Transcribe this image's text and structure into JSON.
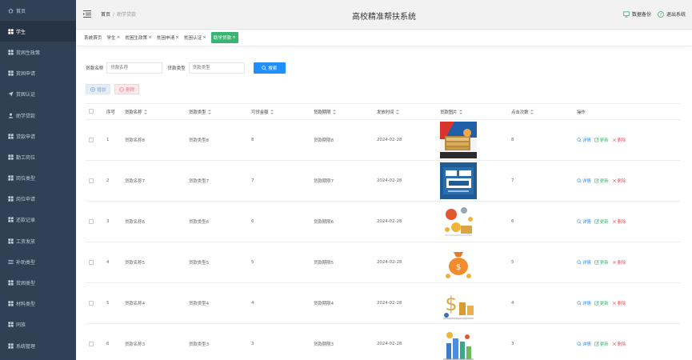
{
  "colors": {
    "sidebar_bg": "#304156",
    "accent_green": "#3bb372",
    "primary_blue": "#1e8ffc",
    "danger_red": "#e25b65"
  },
  "sidebar": {
    "items": [
      {
        "label": "首页",
        "icon": "home-icon"
      },
      {
        "label": "学生",
        "icon": "grid-icon"
      },
      {
        "label": "贫困生政策",
        "icon": "grid-icon"
      },
      {
        "label": "贫困申请",
        "icon": "grid-icon"
      },
      {
        "label": "贫困认证",
        "icon": "send-icon"
      },
      {
        "label": "助学贷款",
        "icon": "user-icon"
      },
      {
        "label": "贷款申请",
        "icon": "grid-icon"
      },
      {
        "label": "勤工岗位",
        "icon": "grid-icon"
      },
      {
        "label": "岗位类型",
        "icon": "grid-icon"
      },
      {
        "label": "岗位申请",
        "icon": "grid-icon"
      },
      {
        "label": "还款记录",
        "icon": "grid-icon"
      },
      {
        "label": "工资发放",
        "icon": "grid-icon"
      },
      {
        "label": "补助类型",
        "icon": "list-icon"
      },
      {
        "label": "贫困类型",
        "icon": "grid-icon"
      },
      {
        "label": "材料类型",
        "icon": "grid-icon"
      },
      {
        "label": "同族",
        "icon": "grid-icon"
      },
      {
        "label": "系统管理",
        "icon": "grid-icon"
      }
    ]
  },
  "header": {
    "breadcrumb_home": "首页",
    "breadcrumb_current": "助学贷款",
    "title": "高校精准帮扶系统",
    "backup_label": "数据备份",
    "logout_label": "退出系统"
  },
  "tabs": [
    {
      "label": "系统首页",
      "closable": false,
      "active": false
    },
    {
      "label": "学生",
      "closable": true,
      "active": false
    },
    {
      "label": "贫困生政策",
      "closable": true,
      "active": false
    },
    {
      "label": "贫困申请",
      "closable": true,
      "active": false
    },
    {
      "label": "贫困认证",
      "closable": true,
      "active": false
    },
    {
      "label": "助学贷款",
      "closable": true,
      "active": true
    }
  ],
  "tab_close_glyph": "×",
  "search": {
    "name_label": "贷款名称",
    "name_placeholder": "贷款名称",
    "type_label": "贷款类型",
    "type_placeholder": "贷款类型",
    "button_label": "搜索"
  },
  "actions": {
    "add_label": "增加",
    "delete_label": "删除"
  },
  "table": {
    "headers": {
      "index": "序号",
      "name": "贷款名称",
      "type": "贷款类型",
      "amount": "可贷金额",
      "term": "贷款期限",
      "time": "发放时间",
      "image": "贷款图片",
      "clicks": "点击次数",
      "ops": "操作"
    },
    "op_labels": {
      "view": "详情",
      "edit": "更新",
      "delete": "删除"
    },
    "rows": [
      {
        "index": "1",
        "name": "贷款名称8",
        "type": "贷款类型8",
        "amount": "8",
        "term": "贷款期限8",
        "time": "2024-02-28",
        "clicks": "8",
        "image": "dollar-stack-image"
      },
      {
        "index": "2",
        "name": "贷款名称7",
        "type": "贷款类型7",
        "amount": "7",
        "term": "贷款期限7",
        "time": "2024-02-28",
        "clicks": "7",
        "image": "loan-poster-image"
      },
      {
        "index": "3",
        "name": "贷款名称6",
        "type": "贷款类型6",
        "amount": "6",
        "term": "贷款期限6",
        "time": "2024-02-28",
        "clicks": "6",
        "image": "coins-illustration-image"
      },
      {
        "index": "4",
        "name": "贷款名称5",
        "type": "贷款类型5",
        "amount": "5",
        "term": "贷款期限5",
        "time": "2024-02-28",
        "clicks": "5",
        "image": "money-bag-image"
      },
      {
        "index": "5",
        "name": "贷款名称4",
        "type": "贷款类型4",
        "amount": "4",
        "term": "贷款期限4",
        "time": "2024-02-28",
        "clicks": "4",
        "image": "dollar-sign-image"
      },
      {
        "index": "6",
        "name": "贷款名称3",
        "type": "贷款类型3",
        "amount": "3",
        "term": "贷款期限3",
        "time": "2024-02-28",
        "clicks": "3",
        "image": "city-coins-image"
      }
    ]
  }
}
